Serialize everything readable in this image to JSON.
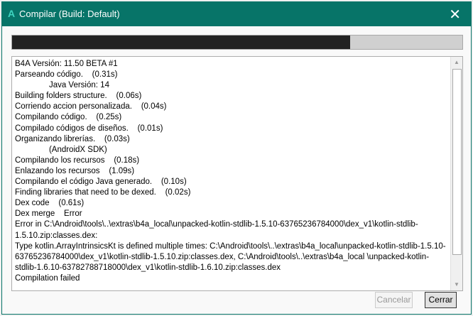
{
  "window": {
    "title": "Compilar (Build: Default)",
    "logo": "A",
    "accent": "#077468"
  },
  "progress": {
    "percent": 75
  },
  "log": [
    "B4A Versión: 11.50 BETA #1",
    "Parseando código.    (0.31s)",
    "               Java Versión: 14",
    "Building folders structure.    (0.06s)",
    "Corriendo accion personalizada.    (0.04s)",
    "Compilando código.    (0.25s)",
    "Compilado códigos de diseños.    (0.01s)",
    "Organizando librerías.    (0.03s)",
    "               (AndroidX SDK)",
    "Compilando los recursos    (0.18s)",
    "Enlazando los recursos    (1.09s)",
    "Compilando el código Java generado.    (0.10s)",
    "Finding libraries that need to be dexed.    (0.02s)",
    "Dex code    (0.61s)",
    "Dex merge    Error",
    "Error in C:\\Android\\tools\\..\\extras\\b4a_local\\unpacked-kotlin-stdlib-1.5.10-63765236784000\\dex_v1\\kotlin-stdlib-1.5.10.zip:classes.dex:",
    "Type kotlin.ArrayIntrinsicsKt is defined multiple times: C:\\Android\\tools\\..\\extras\\b4a_local\\unpacked-kotlin-stdlib-1.5.10-63765236784000\\dex_v1\\kotlin-stdlib-1.5.10.zip:classes.dex, C:\\Android\\tools\\..\\extras\\b4a_local \\unpacked-kotlin-stdlib-1.6.10-63782788718000\\dex_v1\\kotlin-stdlib-1.6.10.zip:classes.dex",
    "Compilation failed"
  ],
  "buttons": {
    "cancel": "Cancelar",
    "close": "Cerrar"
  }
}
